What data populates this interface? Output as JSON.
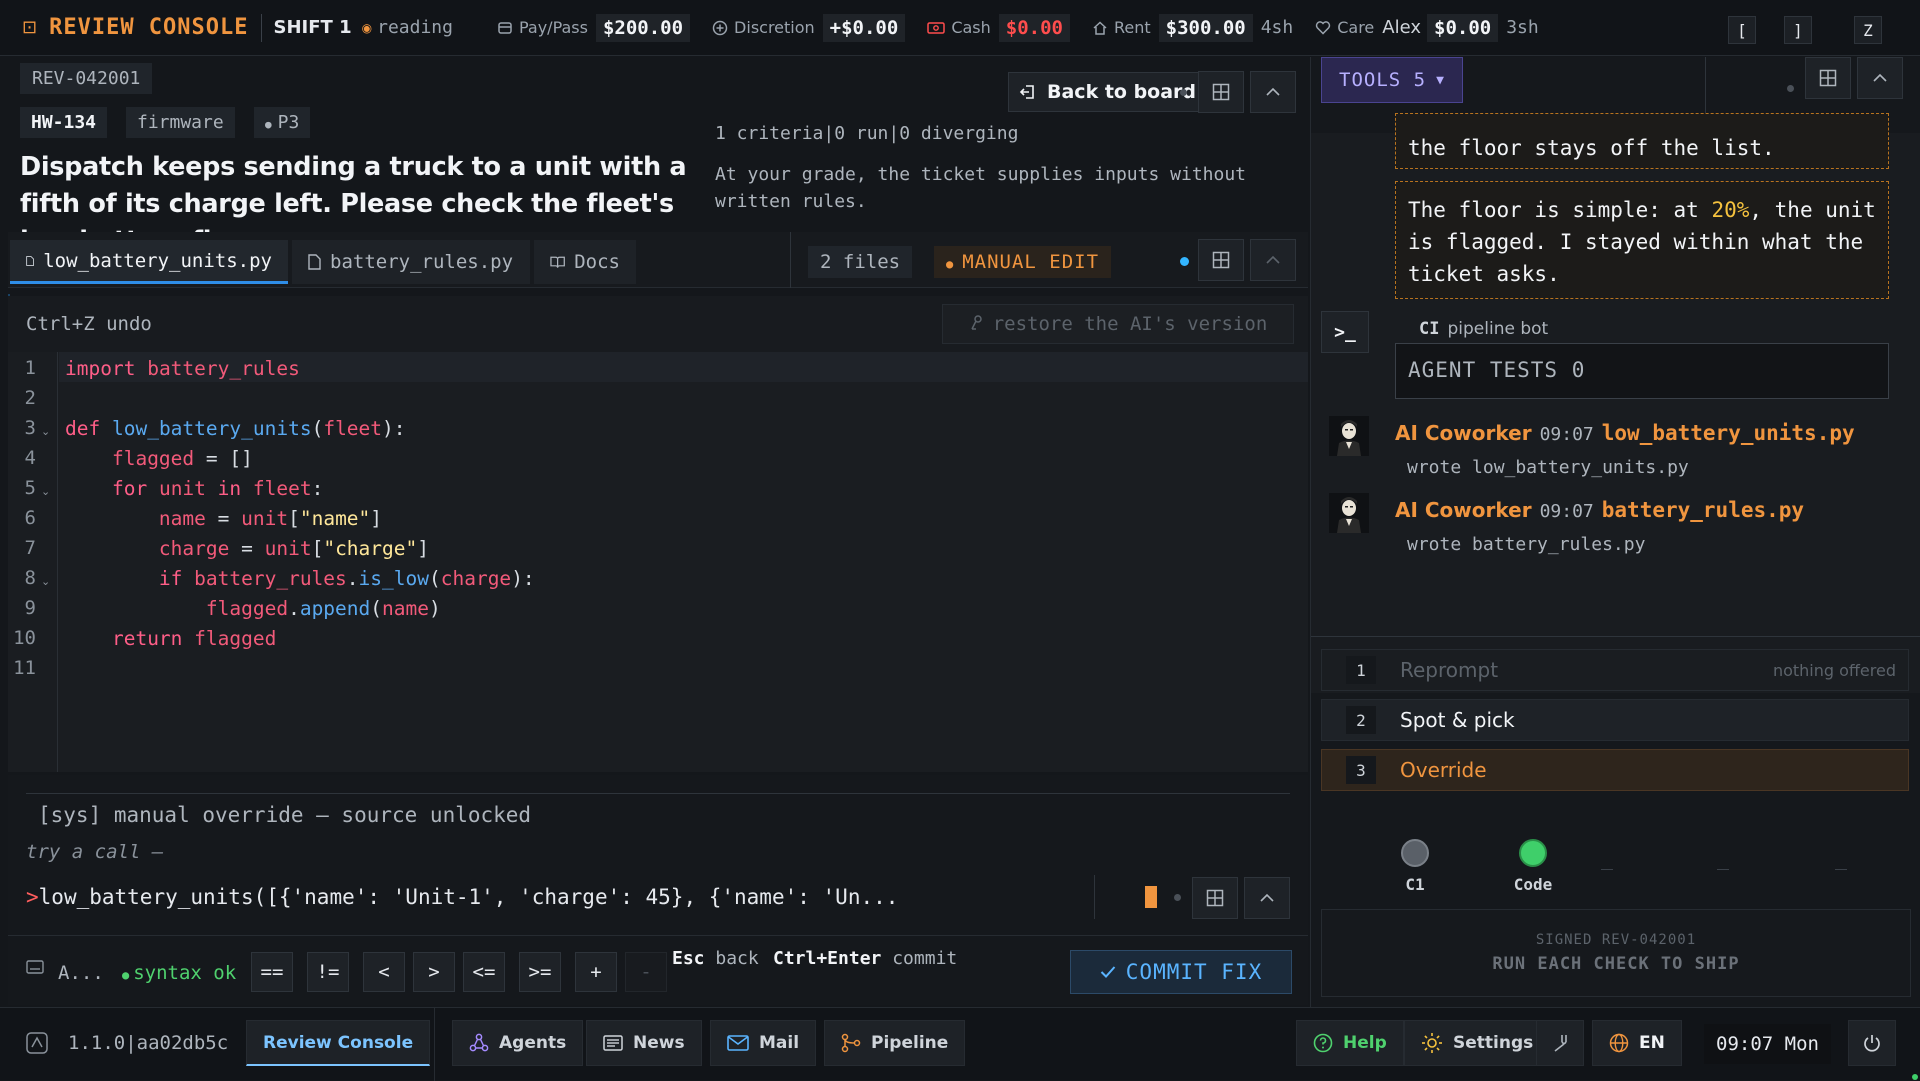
{
  "topbar": {
    "app_title": "REVIEW CONSOLE",
    "shift": "SHIFT 1",
    "status": "reading",
    "pay": {
      "label": "Pay/Pass",
      "value": "$200.00"
    },
    "discretion": {
      "label": "Discretion",
      "value": "+$0.00"
    },
    "cash": {
      "label": "Cash",
      "value": "$0.00"
    },
    "rent": {
      "label": "Rent",
      "value": "$300.00",
      "extra": "4sh"
    },
    "care": {
      "label": "Care",
      "name": "Alex",
      "value": "$0.00",
      "extra": "3sh"
    },
    "keys": [
      "[",
      "]",
      "Z"
    ]
  },
  "ticket": {
    "rev_id": "REV-042001",
    "hw_id": "HW-134",
    "component": "firmware",
    "priority": "P3",
    "title": "Dispatch keeps sending a truck to a unit with a fifth of its charge left. Please check the fleet's low-battery flag.",
    "criteria": "1 criteria|0 run|0 diverging",
    "note": "At your grade, the ticket supplies inputs without written rules.",
    "back_label": "Back to board"
  },
  "tabs": {
    "files": [
      {
        "label": "low_battery_units.py",
        "icon": "file-icon"
      },
      {
        "label": "battery_rules.py",
        "icon": "file-icon"
      },
      {
        "label": "Docs",
        "icon": "book-icon"
      }
    ],
    "file_count": "2 files",
    "mode": "MANUAL EDIT"
  },
  "editor": {
    "undo_hint": "Ctrl+Z undo",
    "restore_label": "restore the AI's version",
    "line_numbers": [
      "1",
      "2",
      "3",
      "4",
      "5",
      "6",
      "7",
      "8",
      "9",
      "10",
      "11"
    ]
  },
  "code": {
    "l1": {
      "kw": "import",
      "mod": "battery_rules"
    },
    "l3": {
      "kw": "def",
      "fn": "low_battery_units",
      "open": "(",
      "arg": "fleet",
      "close": "):"
    },
    "l4": {
      "var": "flagged",
      "rest": " = []"
    },
    "l5": {
      "kw1": "for",
      "var": "unit",
      "kw2": "in",
      "obj": "fleet",
      "colon": ":"
    },
    "l6": {
      "var": "name",
      "eq": " = ",
      "obj": "unit",
      "lb": "[",
      "str": "\"name\"",
      "rb": "]"
    },
    "l7": {
      "var": "charge",
      "eq": " = ",
      "obj": "unit",
      "lb": "[",
      "str": "\"charge\"",
      "rb": "]"
    },
    "l8": {
      "kw": "if",
      "obj": "battery_rules",
      "dot": ".",
      "fn": "is_low",
      "open": "(",
      "arg": "charge",
      "close": "):"
    },
    "l9": {
      "obj": "flagged",
      "dot": ".",
      "fn": "append",
      "open": "(",
      "arg": "name",
      "close": ")"
    },
    "l10": {
      "kw": "return",
      "var": "flagged"
    }
  },
  "console": {
    "sys": "[sys] manual override — source unlocked",
    "try": "try a call —",
    "prompt_symbol": ">",
    "input": "low_battery_units([{'name': 'Unit-1', 'charge': 45}, {'name': 'Un..."
  },
  "toolbar": {
    "a_label": "A...",
    "syntax": "syntax ok",
    "ops": [
      "==",
      "!=",
      "<",
      ">",
      "<=",
      ">=",
      "+",
      "-"
    ],
    "esc_key": "Esc",
    "esc_label": "back",
    "commit_key": "Ctrl+Enter",
    "commit_label": "commit",
    "commit_button": "COMMIT FIX"
  },
  "sidebar": {
    "tools_label": "TOOLS 5",
    "msg_partial": "the floor stays off the list.",
    "msg_main_a": "The floor is simple: at ",
    "msg_main_hl": "20%",
    "msg_main_b": ", the unit is flagged. I stayed within what the ticket asks.",
    "ci_tag": "CI",
    "ci_name": "pipeline bot",
    "agent_tests": "AGENT TESTS 0",
    "coworker_msgs": [
      {
        "name": "AI Coworker",
        "time": "09:07",
        "file": "low_battery_units.py",
        "note": "wrote low_battery_units.py"
      },
      {
        "name": "AI Coworker",
        "time": "09:07",
        "file": "battery_rules.py",
        "note": "wrote battery_rules.py"
      }
    ],
    "options": [
      {
        "num": "1",
        "label": "Reprompt",
        "side": "nothing offered"
      },
      {
        "num": "2",
        "label": "Spot & pick"
      },
      {
        "num": "3",
        "label": "Override"
      }
    ],
    "checks": [
      {
        "label": "C1",
        "color": "#5a6068"
      },
      {
        "label": "Code",
        "color": "#3fcf6a"
      }
    ],
    "ship_signed": "SIGNED REV-042001",
    "ship_label": "RUN EACH CHECK TO SHIP"
  },
  "footer": {
    "version": "1.1.0|aa02db5c",
    "tabs": [
      "Review Console",
      "Agents",
      "News",
      "Mail",
      "Pipeline"
    ],
    "help": "Help",
    "settings": "Settings",
    "lang": "EN",
    "clock": "09:07 Mon"
  },
  "colors": {
    "accent": "#f0953f",
    "link": "#2f8ee8",
    "ok": "#3fcf6a",
    "danger": "#ff4d4d",
    "tools": "#b7b0ff"
  }
}
